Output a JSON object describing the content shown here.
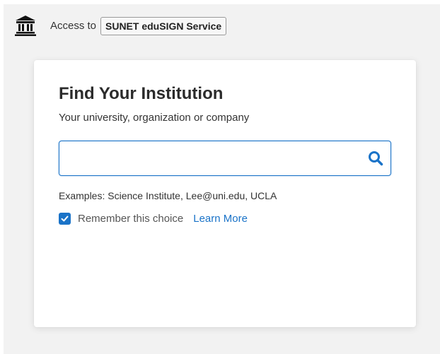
{
  "header": {
    "icon": "institution-icon",
    "access_label": "Access to",
    "service_name": "SUNET eduSIGN Service"
  },
  "card": {
    "title": "Find Your Institution",
    "subtitle": "Your university, organization or company",
    "search": {
      "value": "",
      "placeholder": "",
      "icon": "search-icon"
    },
    "examples": "Examples: Science Institute, Lee@uni.edu, UCLA",
    "remember": {
      "checked": true,
      "label": "Remember this choice",
      "icon": "checkmark-icon"
    },
    "learn_more": "Learn More"
  },
  "colors": {
    "accent": "#1a73c8",
    "page_background": "#f2f2f2",
    "card_background": "#ffffff",
    "text": "#333333"
  }
}
